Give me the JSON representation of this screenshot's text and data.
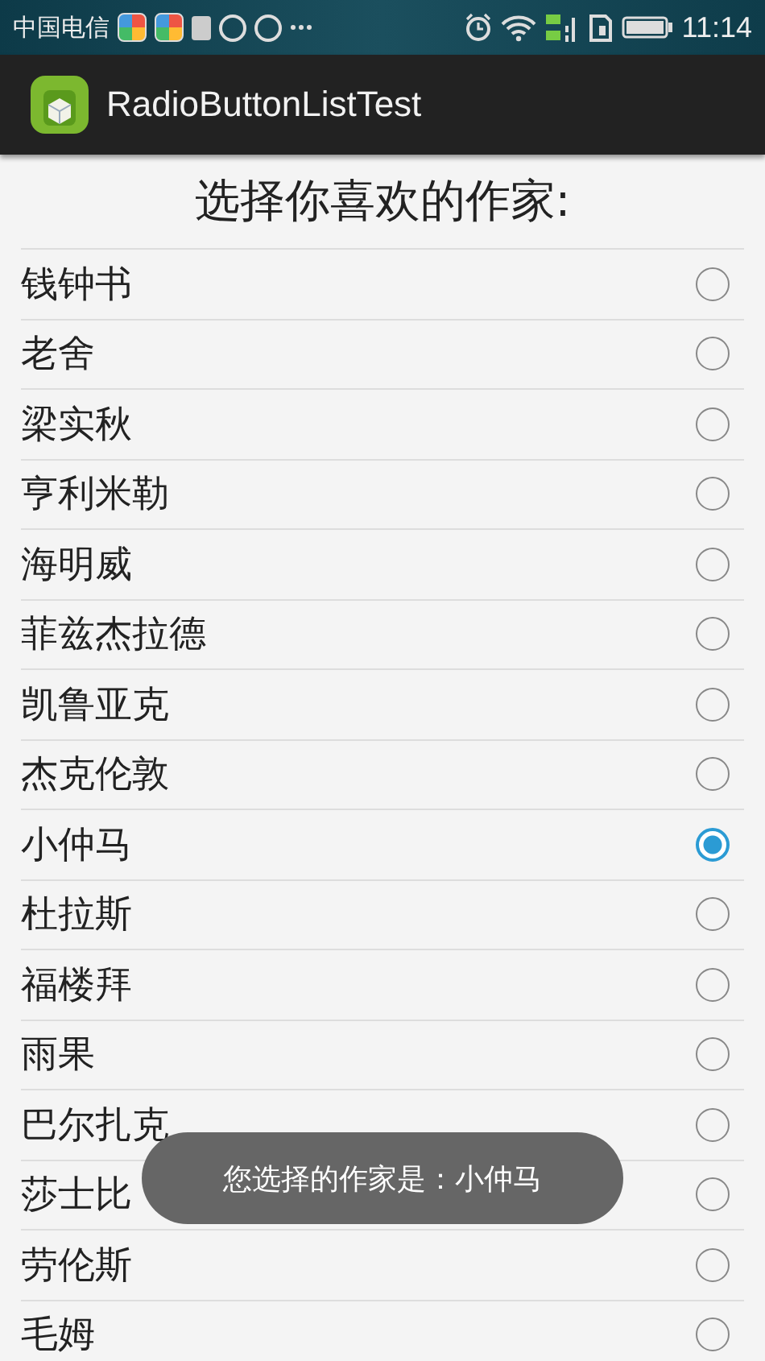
{
  "status_bar": {
    "carrier": "中国电信",
    "time": "11:14"
  },
  "action_bar": {
    "title": "RadioButtonListTest"
  },
  "heading": "选择你喜欢的作家:",
  "writers": [
    {
      "name": "钱钟书",
      "selected": false
    },
    {
      "name": "老舍",
      "selected": false
    },
    {
      "name": "梁实秋",
      "selected": false
    },
    {
      "name": "亨利米勒",
      "selected": false
    },
    {
      "name": "海明威",
      "selected": false
    },
    {
      "name": "菲兹杰拉德",
      "selected": false
    },
    {
      "name": "凯鲁亚克",
      "selected": false
    },
    {
      "name": "杰克伦敦",
      "selected": false
    },
    {
      "name": "小仲马",
      "selected": true
    },
    {
      "name": "杜拉斯",
      "selected": false
    },
    {
      "name": "福楼拜",
      "selected": false
    },
    {
      "name": "雨果",
      "selected": false
    },
    {
      "name": "巴尔扎克",
      "selected": false
    },
    {
      "name": "莎士比",
      "selected": false
    },
    {
      "name": "劳伦斯",
      "selected": false
    },
    {
      "name": "毛姆",
      "selected": false
    }
  ],
  "toast": "您选择的作家是：小仲马"
}
